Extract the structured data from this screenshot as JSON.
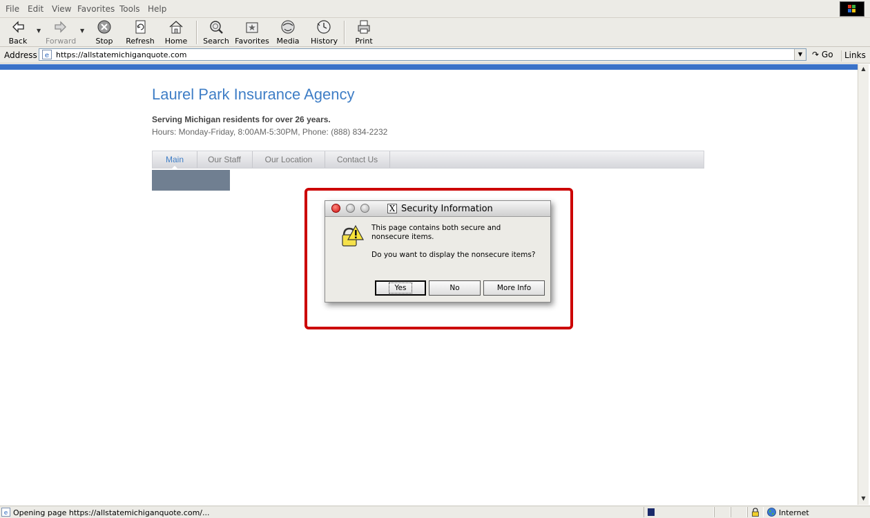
{
  "menubar": {
    "items": [
      "File",
      "Edit",
      "View",
      "Favorites",
      "Tools",
      "Help"
    ]
  },
  "toolbar": {
    "back": "Back",
    "forward": "Forward",
    "stop": "Stop",
    "refresh": "Refresh",
    "home": "Home",
    "search": "Search",
    "favorites": "Favorites",
    "media": "Media",
    "history": "History",
    "print": "Print"
  },
  "address": {
    "label": "Address",
    "url": "https://allstatemichiganquote.com",
    "go": "Go",
    "links": "Links"
  },
  "page": {
    "title": "Laurel Park Insurance Agency",
    "tagline": "Serving Michigan residents for over 26 years.",
    "hours": "Hours: Monday-Friday, 8:00AM-5:30PM, Phone: (888) 834-2232",
    "nav": [
      "Main",
      "Our Staff",
      "Our Location",
      "Contact Us"
    ]
  },
  "dialog": {
    "title": "Security Information",
    "message1": "This page contains both secure and nonsecure items.",
    "message2": "Do you want to display the nonsecure items?",
    "yes": "Yes",
    "no": "No",
    "more_info": "More Info",
    "highlight_color": "#cc0000"
  },
  "status": {
    "text": "Opening page https://allstatemichiganquote.com/...",
    "zone": "Internet"
  },
  "colors": {
    "accent": "#3a72c8",
    "title": "#3f7ec6"
  }
}
